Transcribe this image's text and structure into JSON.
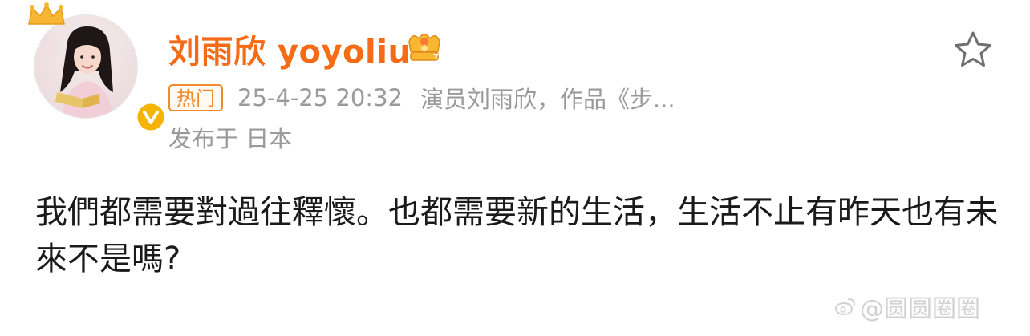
{
  "post": {
    "username": "刘雨欣 yoyoliu",
    "tag": "热门",
    "timestamp": "25-4-25 20:32",
    "source": "演员刘雨欣，作品《步...",
    "location": "发布于 日本",
    "body": "我們都需要對過往釋懷。也都需要新的生活，生活不止有昨天也有未來不是嗎?"
  },
  "watermark": {
    "text": "@圆圆圈圈"
  },
  "icons": {
    "avatar": "avatar-photo",
    "verified": "verified-badge-icon",
    "vip": "vip-crown-icon",
    "favorite": "star-outline-icon"
  },
  "colors": {
    "username": "#f56b16",
    "tag": "#f08a2c",
    "meta": "#9a9a9a",
    "body": "#1a1a1a",
    "verified": "#f5b400"
  }
}
